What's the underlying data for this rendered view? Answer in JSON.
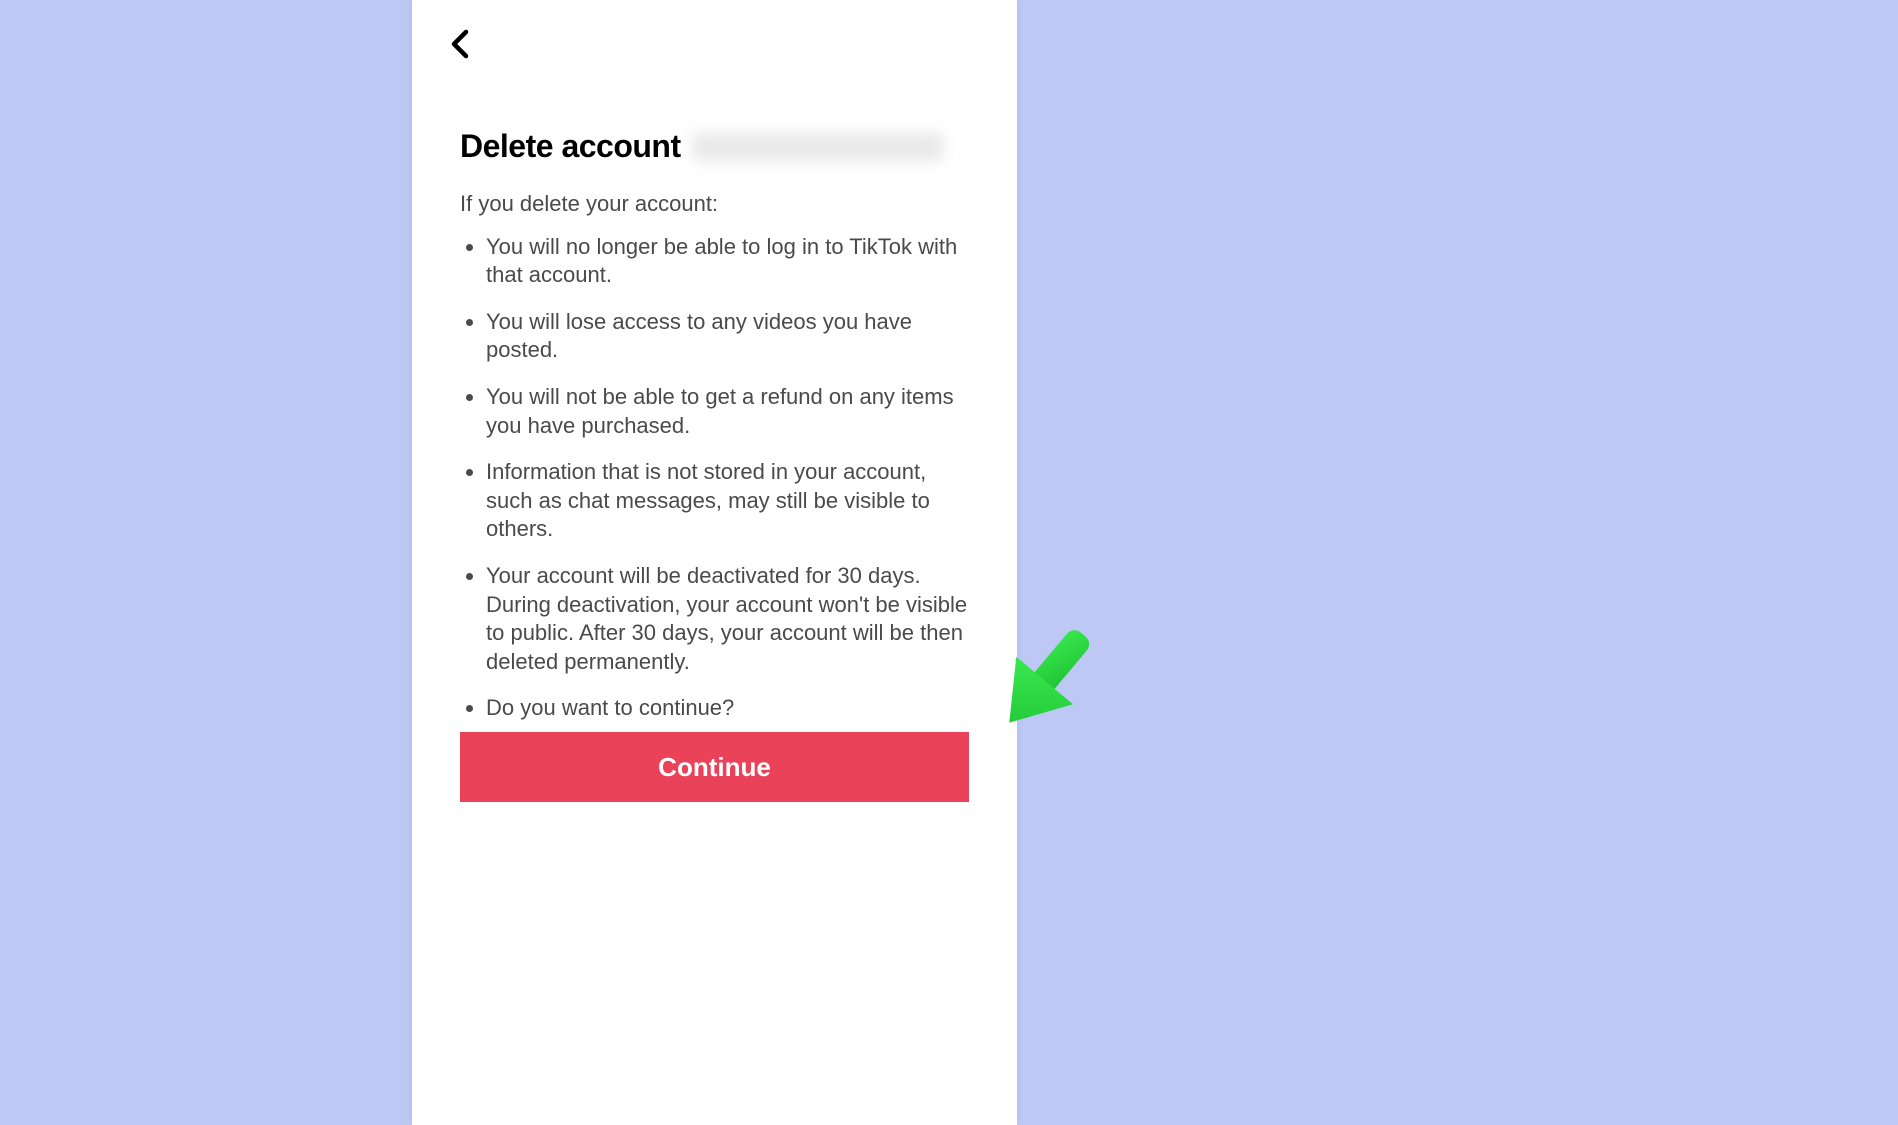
{
  "header": {
    "back_icon": "chevron-left"
  },
  "title_prefix": "Delete account",
  "intro": "If you delete your account:",
  "bullets": [
    "You will no longer be able to log in to TikTok with that account.",
    "You will lose access to any videos you have posted.",
    "You will not be able to get a refund on any items you have purchased.",
    "Information that is not stored in your account, such as chat messages, may still be visible to others.",
    "Your account will be deactivated for 30 days. During deactivation, your account won't be visible to public. After 30 days, your account will be then deleted permanently.",
    "Do you want to continue?"
  ],
  "continue_label": "Continue",
  "colors": {
    "page_bg": "#bdc8f5",
    "panel_bg": "#ffffff",
    "text_primary": "#000000",
    "text_body": "#4a4a4a",
    "button_bg": "#ea4359",
    "button_text": "#ffffff",
    "annotation_arrow": "#2bd43f"
  }
}
